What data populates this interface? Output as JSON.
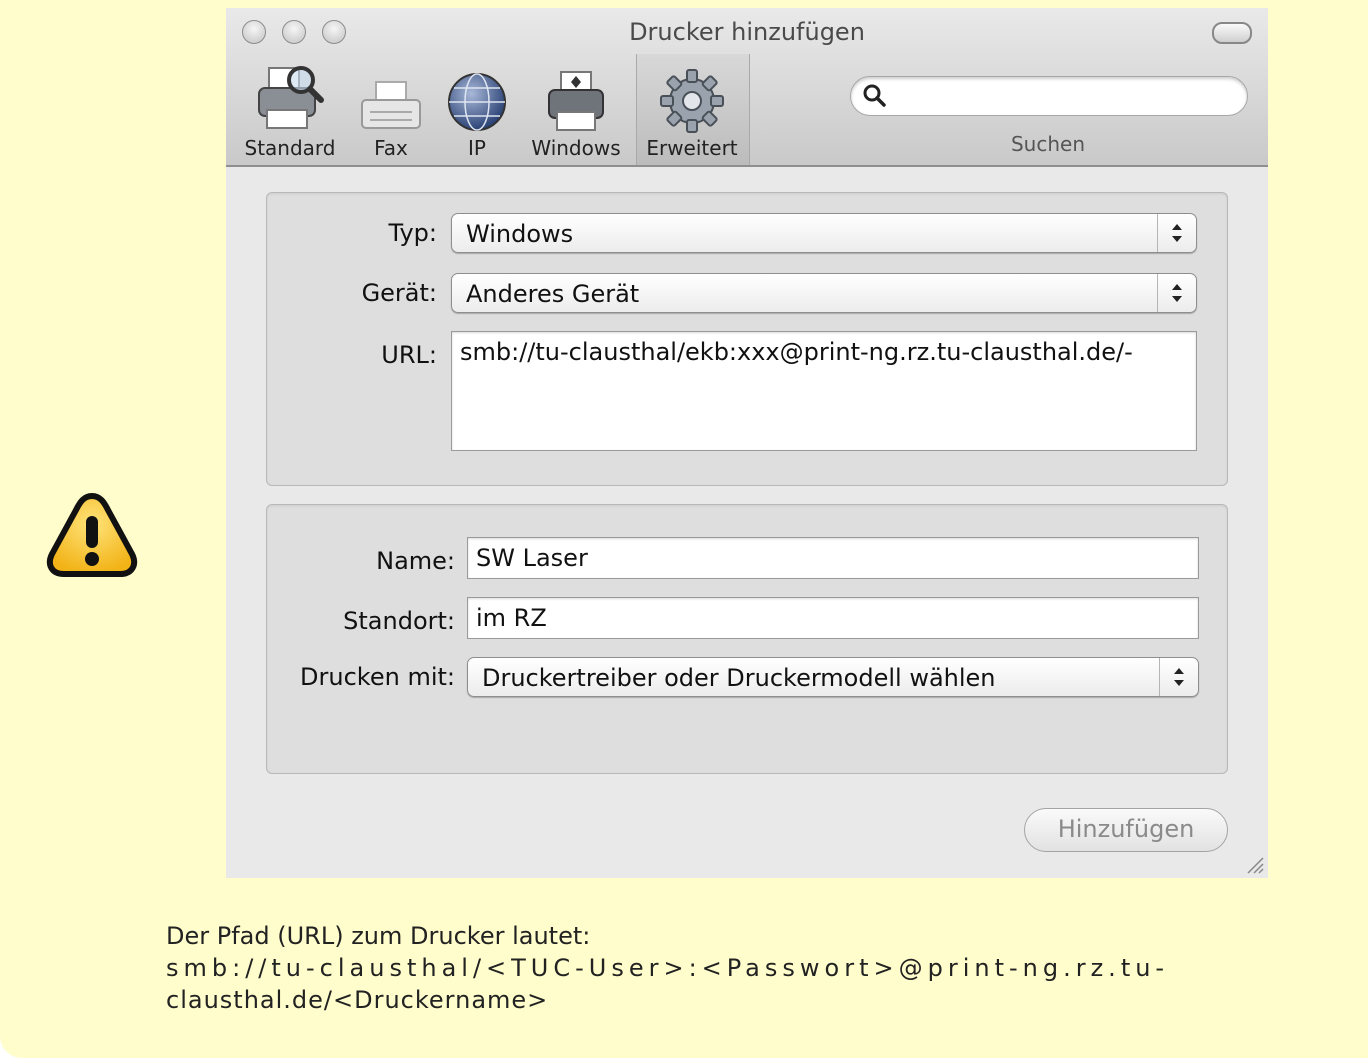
{
  "window": {
    "title": "Drucker hinzufügen",
    "toolbar": [
      {
        "label": "Standard",
        "icon": "printer-magnifier-icon"
      },
      {
        "label": "Fax",
        "icon": "fax-icon"
      },
      {
        "label": "IP",
        "icon": "globe-icon"
      },
      {
        "label": "Windows",
        "icon": "network-printer-icon"
      },
      {
        "label": "Erweitert",
        "icon": "gear-icon",
        "selected": true
      }
    ],
    "search": {
      "label": "Suchen",
      "value": ""
    }
  },
  "connection": {
    "typ_label": "Typ:",
    "typ_value": "Windows",
    "geraet_label": "Gerät:",
    "geraet_value": "Anderes Gerät",
    "url_label": "URL:",
    "url_value": "smb://tu-clausthal/ekb:xxx@print-ng.rz.tu-clausthal.de/-"
  },
  "details": {
    "name_label": "Name:",
    "name_value": "SW Laser",
    "standort_label": "Standort:",
    "standort_value": " im RZ",
    "drucken_label": "Drucken mit:",
    "drucken_value": "Druckertreiber oder Druckermodell wählen"
  },
  "add_button": "Hinzufügen",
  "caption": {
    "line1": "Der Pfad (URL) zum Drucker lautet:",
    "line2": "smb://tu-clausthal/<TUC-User>:<Passwort>@print-ng.rz.tu-",
    "line3": "clausthal.de/<Druckername>"
  },
  "colors": {
    "note_background": "#fffdcc",
    "warning": "#f7c531"
  }
}
